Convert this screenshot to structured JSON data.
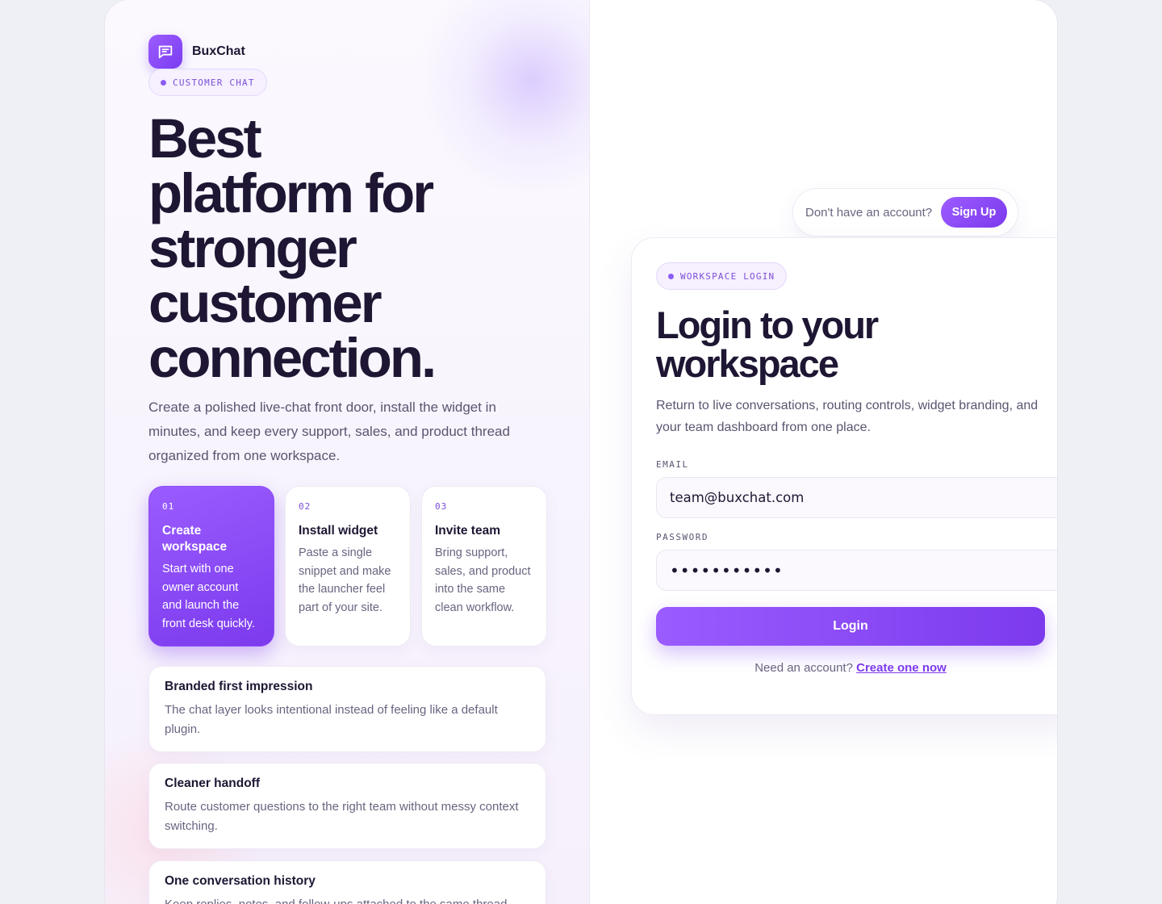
{
  "brand": {
    "name": "BuxChat",
    "accent_color": "#7c3aed",
    "logo_icon": "chat-bubble-icon"
  },
  "left": {
    "badge": "CUSTOMER CHAT",
    "hero_lines": [
      "Best",
      "platform for",
      "stronger",
      "customer",
      "connection."
    ],
    "lead": "Create a polished live-chat front door, install the widget in minutes, and keep every support, sales, and product thread organized from one workspace.",
    "steps": [
      {
        "num": "01",
        "title": "Create workspace",
        "desc": "Start with one owner account and launch the front desk quickly.",
        "active": true
      },
      {
        "num": "02",
        "title": "Install widget",
        "desc": "Paste a single snippet and make the launcher feel part of your site.",
        "active": false
      },
      {
        "num": "03",
        "title": "Invite team",
        "desc": "Bring support, sales, and product into the same clean workflow.",
        "active": false
      }
    ],
    "features": [
      {
        "title": "Branded first impression",
        "desc": "The chat layer looks intentional instead of feeling like a default plugin."
      },
      {
        "title": "Cleaner handoff",
        "desc": "Route customer questions to the right team without messy context switching."
      },
      {
        "title": "One conversation history",
        "desc": "Keep replies, notes, and follow-ups attached to the same thread."
      }
    ]
  },
  "signup": {
    "prompt": "Don't have an account?",
    "button": "Sign Up"
  },
  "login": {
    "badge": "WORKSPACE LOGIN",
    "title_lines": [
      "Login to your",
      "workspace"
    ],
    "subtitle": "Return to live conversations, routing controls, widget branding, and your team dashboard from one place.",
    "email_label": "EMAIL",
    "email_value": "team@buxchat.com",
    "password_label": "PASSWORD",
    "password_value": "•••••••••••",
    "submit": "Login",
    "need_account": "Need an account?",
    "create_link": "Create one now"
  }
}
